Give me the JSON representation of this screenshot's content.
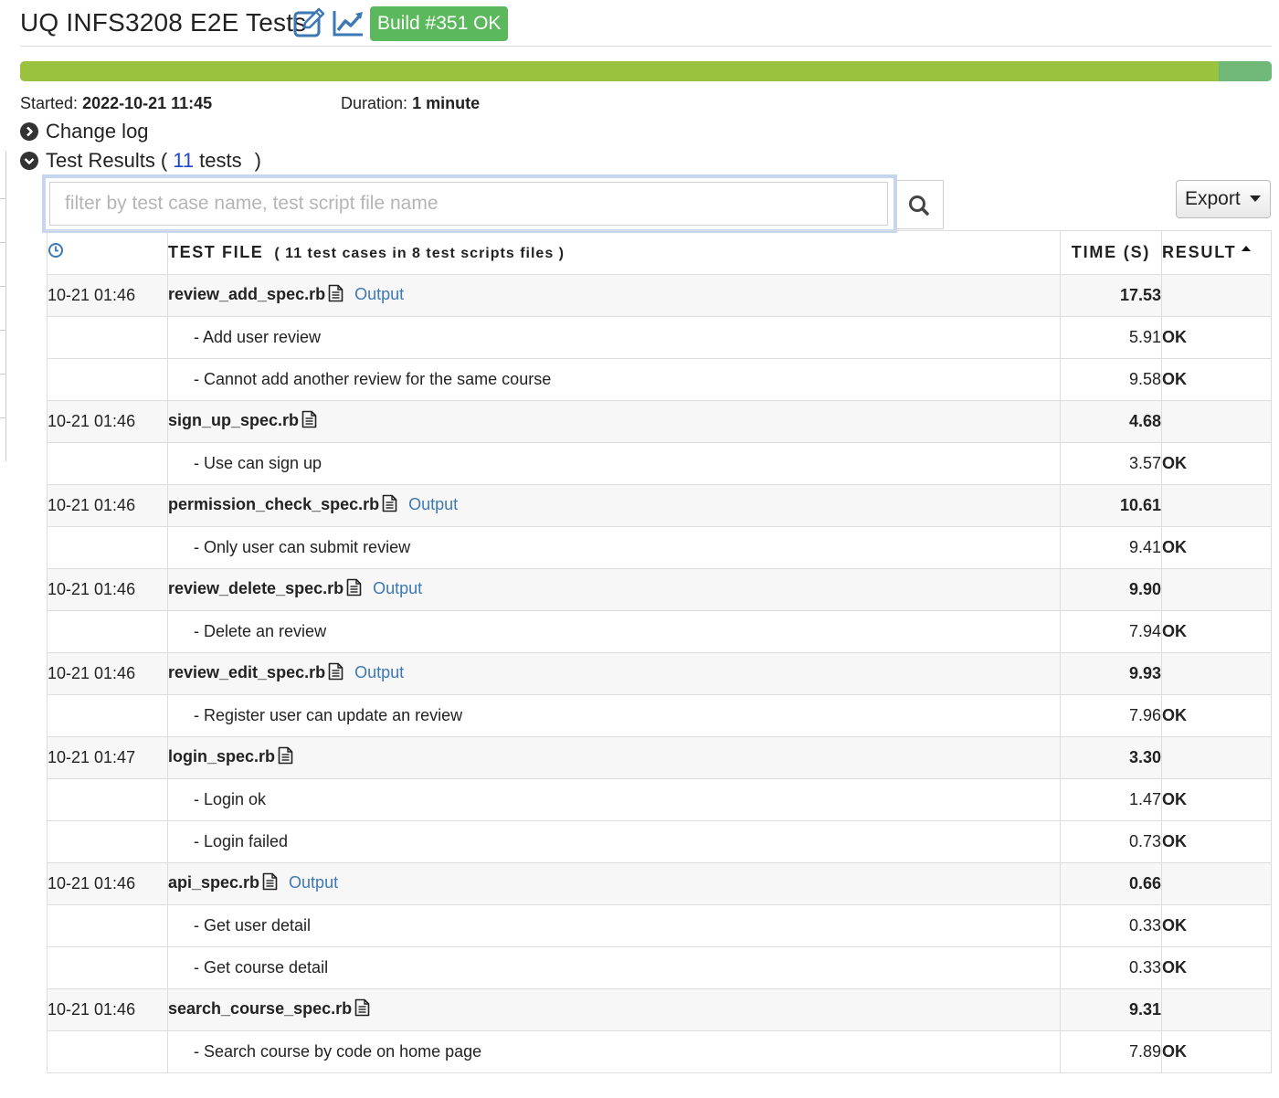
{
  "header": {
    "title": "UQ INFS3208 E2E Tests",
    "build_badge": "Build #351 OK"
  },
  "progress": {
    "passed_fraction": 0.958
  },
  "meta": {
    "started_label": "Started:",
    "started_value": "2022-10-21 11:45",
    "duration_label": "Duration:",
    "duration_value": "1 minute"
  },
  "sections": {
    "change_log": "Change log",
    "test_results_prefix": "Test Results (",
    "test_results_count": "11",
    "test_results_suffix": "tests",
    "test_results_close": ")"
  },
  "filter": {
    "placeholder": "filter by test case name, test script file name",
    "value": ""
  },
  "export_label": "Export",
  "table": {
    "headers": {
      "test_file": "TEST FILE",
      "test_file_sub": "( 11 test cases in 8 test scripts files )",
      "time": "TIME (S)",
      "result": "RESULT"
    },
    "files": [
      {
        "time": "10-21 01:46",
        "name": "review_add_spec.rb",
        "output": "Output",
        "duration": "17.53",
        "cases": [
          {
            "name": "- Add user review",
            "duration": "5.91",
            "result": "OK"
          },
          {
            "name": "- Cannot add another review for the same course",
            "duration": "9.58",
            "result": "OK"
          }
        ]
      },
      {
        "time": "10-21 01:46",
        "name": "sign_up_spec.rb",
        "output": "",
        "duration": "4.68",
        "cases": [
          {
            "name": "- Use can sign up",
            "duration": "3.57",
            "result": "OK"
          }
        ]
      },
      {
        "time": "10-21 01:46",
        "name": "permission_check_spec.rb",
        "output": "Output",
        "duration": "10.61",
        "cases": [
          {
            "name": "- Only user can submit review",
            "duration": "9.41",
            "result": "OK"
          }
        ]
      },
      {
        "time": "10-21 01:46",
        "name": "review_delete_spec.rb",
        "output": "Output",
        "duration": "9.90",
        "cases": [
          {
            "name": "- Delete an review",
            "duration": "7.94",
            "result": "OK"
          }
        ]
      },
      {
        "time": "10-21 01:46",
        "name": "review_edit_spec.rb",
        "output": "Output",
        "duration": "9.93",
        "cases": [
          {
            "name": "- Register user can update an review",
            "duration": "7.96",
            "result": "OK"
          }
        ]
      },
      {
        "time": "10-21 01:47",
        "name": "login_spec.rb",
        "output": "",
        "duration": "3.30",
        "cases": [
          {
            "name": "- Login ok",
            "duration": "1.47",
            "result": "OK"
          },
          {
            "name": "- Login failed",
            "duration": "0.73",
            "result": "OK"
          }
        ]
      },
      {
        "time": "10-21 01:46",
        "name": "api_spec.rb",
        "output": "Output",
        "duration": "0.66",
        "cases": [
          {
            "name": "- Get user detail",
            "duration": "0.33",
            "result": "OK"
          },
          {
            "name": "- Get course detail",
            "duration": "0.33",
            "result": "OK"
          }
        ]
      },
      {
        "time": "10-21 01:46",
        "name": "search_course_spec.rb",
        "output": "",
        "duration": "9.31",
        "cases": [
          {
            "name": "- Search course by code on home page",
            "duration": "7.89",
            "result": "OK"
          }
        ]
      }
    ]
  },
  "icons": {
    "edit": "edit-icon",
    "chart": "chart-icon",
    "clock": "clock-icon",
    "document": "document-icon",
    "search": "search-icon"
  },
  "colors": {
    "badge": "#5cb85c",
    "progress_pass": "#9ac23f",
    "progress_rest": "#6fb877",
    "link": "#3c78b4",
    "ok": "#3e7d2e"
  }
}
